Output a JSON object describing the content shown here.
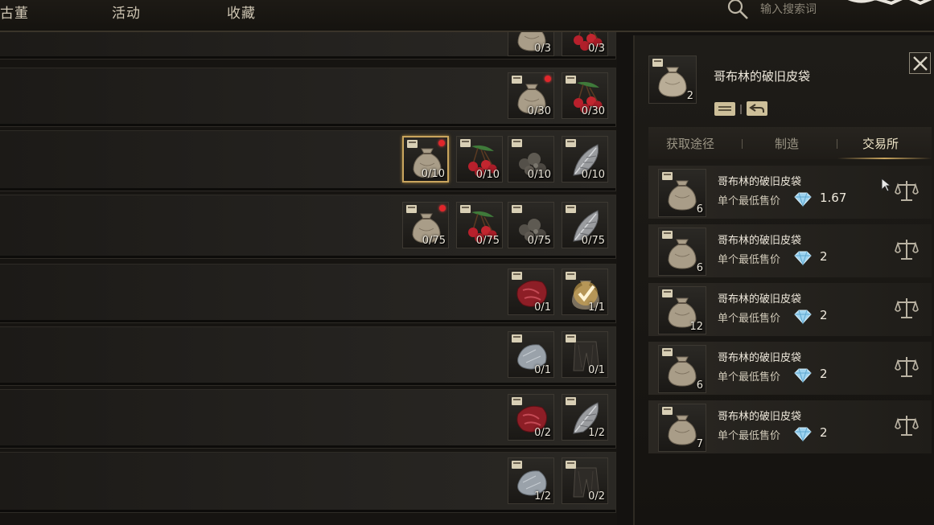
{
  "top_tabs": [
    "古董",
    "活动",
    "收藏"
  ],
  "search": {
    "placeholder": "输入搜索词"
  },
  "rows": [
    {
      "slots": [
        {
          "icon": "pouch-icon",
          "count": "0/3"
        },
        {
          "icon": "cherry-icon",
          "count": "0/3"
        }
      ]
    },
    {
      "slots": [
        {
          "icon": "pouch-icon",
          "count": "0/30",
          "alert": true
        },
        {
          "icon": "cherry-icon",
          "count": "0/30"
        }
      ]
    },
    {
      "slots": [
        {
          "icon": "pouch-icon",
          "count": "0/10",
          "alert": true,
          "selected": true
        },
        {
          "icon": "cherry-icon",
          "count": "0/10"
        },
        {
          "icon": "ore-icon",
          "count": "0/10"
        },
        {
          "icon": "feather-icon",
          "count": "0/10"
        }
      ]
    },
    {
      "slots": [
        {
          "icon": "pouch-icon",
          "count": "0/75",
          "alert": true
        },
        {
          "icon": "cherry-icon",
          "count": "0/75"
        },
        {
          "icon": "ore-icon",
          "count": "0/75"
        },
        {
          "icon": "feather-icon",
          "count": "0/75"
        }
      ]
    },
    {
      "slots": [
        {
          "icon": "meat-icon",
          "count": "0/1"
        },
        {
          "icon": "completed-check-icon",
          "count": "1/1",
          "done": true
        }
      ]
    },
    {
      "slots": [
        {
          "icon": "stone-icon",
          "count": "0/1"
        },
        {
          "icon": "cloth-icon",
          "count": "0/1"
        }
      ]
    },
    {
      "slots": [
        {
          "icon": "meat-icon",
          "count": "0/2"
        },
        {
          "icon": "feather-icon",
          "count": "1/2"
        }
      ]
    },
    {
      "slots": [
        {
          "icon": "stone-icon",
          "count": "1/2"
        },
        {
          "icon": "cloth-icon",
          "count": "0/2"
        }
      ]
    }
  ],
  "detail": {
    "title": "哥布林的破旧皮袋",
    "owned_count": "2",
    "tabs": [
      {
        "label": "获取途径",
        "active": false
      },
      {
        "label": "制造",
        "active": false
      },
      {
        "label": "交易所",
        "active": true
      }
    ],
    "listings": [
      {
        "name": "哥布林的破旧皮袋",
        "label": "单个最低售价",
        "price": "1.67",
        "qty": "6"
      },
      {
        "name": "哥布林的破旧皮袋",
        "label": "单个最低售价",
        "price": "2",
        "qty": "6"
      },
      {
        "name": "哥布林的破旧皮袋",
        "label": "单个最低售价",
        "price": "2",
        "qty": "12"
      },
      {
        "name": "哥布林的破旧皮袋",
        "label": "单个最低售价",
        "price": "2",
        "qty": "6"
      },
      {
        "name": "哥布林的破旧皮袋",
        "label": "单个最低售价",
        "price": "2",
        "qty": "7"
      }
    ]
  },
  "colors": {
    "accent_gold": "#c9a55e",
    "alert_red": "#e0262b",
    "gem_blue": "#9fd4f0"
  }
}
